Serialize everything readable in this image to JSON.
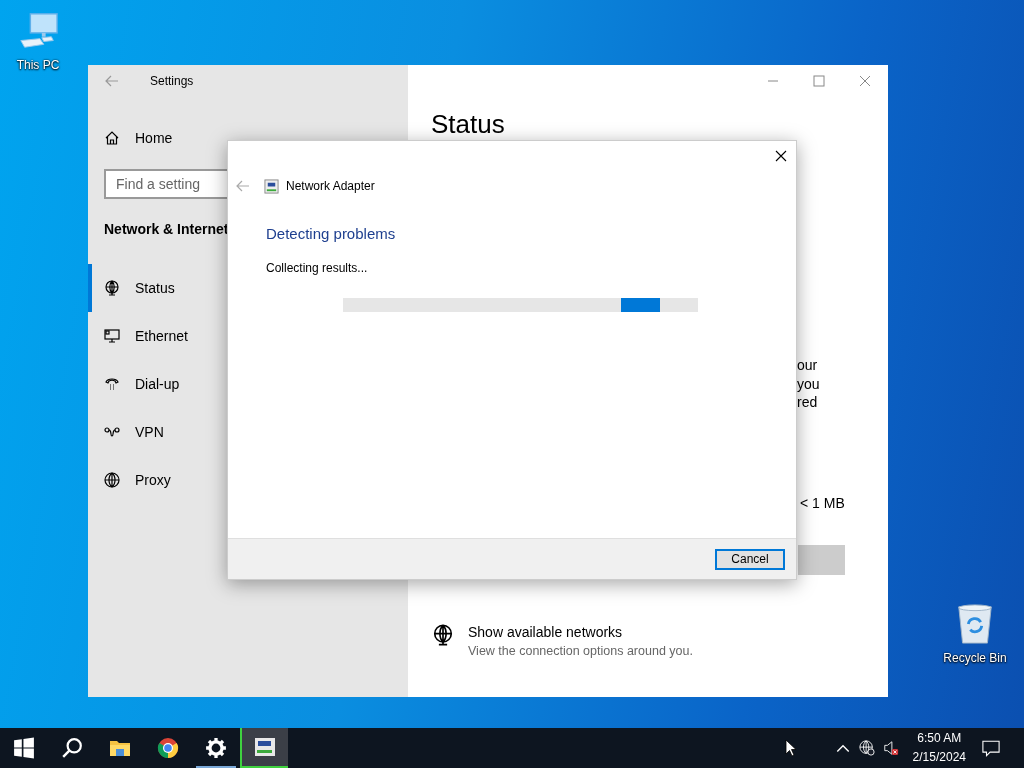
{
  "desktop_icons": [
    {
      "kind": "computer",
      "label": "This PC"
    },
    {
      "kind": "recycle",
      "label": "Recycle Bin"
    }
  ],
  "settings": {
    "title": "Settings",
    "home": "Home",
    "search": {
      "placeholder": "Find a setting"
    },
    "section": "Network & Internet",
    "nav": [
      {
        "kind": "status",
        "label": "Status",
        "selected": true
      },
      {
        "kind": "ethernet",
        "label": "Ethernet",
        "selected": false
      },
      {
        "kind": "dialup",
        "label": "Dial-up",
        "selected": false
      },
      {
        "kind": "vpn",
        "label": "VPN",
        "selected": false
      },
      {
        "kind": "proxy",
        "label": "Proxy",
        "selected": false
      }
    ],
    "heading": "Status",
    "partial_lines": [
      "our",
      "you",
      "red"
    ],
    "data_usage": "< 1 MB",
    "link": {
      "title": "Show available networks",
      "description": "View the connection options around you."
    }
  },
  "dialog": {
    "title": "Network Adapter",
    "heading": "Detecting problems",
    "message": "Collecting results...",
    "progress": {
      "indeterminate": true
    },
    "buttons": [
      "Cancel"
    ]
  },
  "taskbar": {
    "apps": [
      {
        "kind": "start",
        "running": false,
        "active": false
      },
      {
        "kind": "search",
        "running": false,
        "active": false
      },
      {
        "kind": "folder",
        "running": false,
        "active": false
      },
      {
        "kind": "browser",
        "running": false,
        "active": false
      },
      {
        "kind": "gear",
        "running": true,
        "active": false
      },
      {
        "kind": "adapter",
        "running": true,
        "active": true
      }
    ],
    "clock": {
      "time": "6:50 AM",
      "date": "2/15/2024"
    }
  }
}
